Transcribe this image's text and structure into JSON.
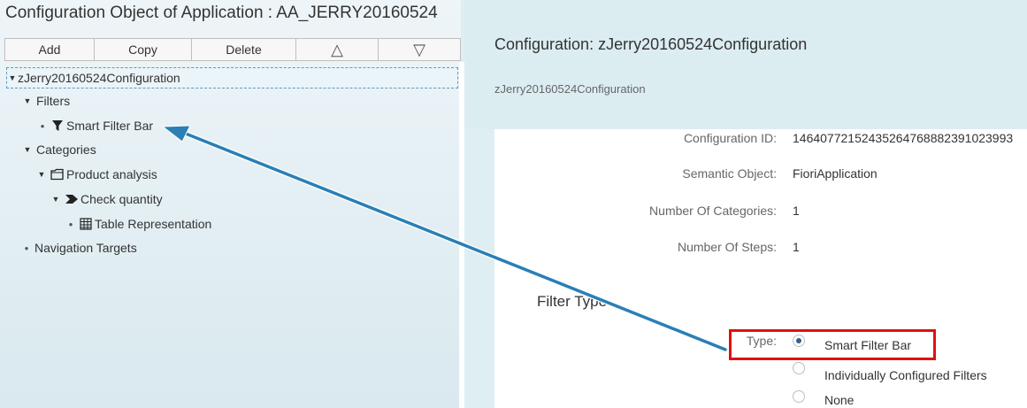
{
  "app": {
    "title": "Configuration Object of Application : AA_JERRY20160524"
  },
  "toolbar": {
    "add_label": "Add",
    "copy_label": "Copy",
    "delete_label": "Delete",
    "up_label": "△",
    "down_label": "▽"
  },
  "tree": {
    "root": "zJerry20160524Configuration",
    "filters": "Filters",
    "smart_filter_bar": "Smart Filter Bar",
    "categories": "Categories",
    "product_analysis": "Product analysis",
    "check_quantity": "Check quantity",
    "table_representation": "Table Representation",
    "navigation_targets": "Navigation Targets"
  },
  "detail": {
    "title": "Configuration: zJerry20160524Configuration",
    "subtitle": "zJerry20160524Configuration",
    "fields": [
      {
        "label": "Configuration ID:",
        "value": "14640772152435264768882391023993"
      },
      {
        "label": "Semantic Object:",
        "value": "FioriApplication"
      },
      {
        "label": "Number Of Categories:",
        "value": "1"
      },
      {
        "label": "Number Of Steps:",
        "value": "1"
      }
    ]
  },
  "filter_type": {
    "section_title": "Filter Type",
    "type_label": "Type:",
    "options": [
      "Smart Filter Bar",
      "Individually Configured Filters",
      "None"
    ],
    "selected": "Smart Filter Bar"
  },
  "colors": {
    "accent": "#346187",
    "annotation_arrow": "#2a7fb5",
    "annotation_box": "#e01010"
  }
}
